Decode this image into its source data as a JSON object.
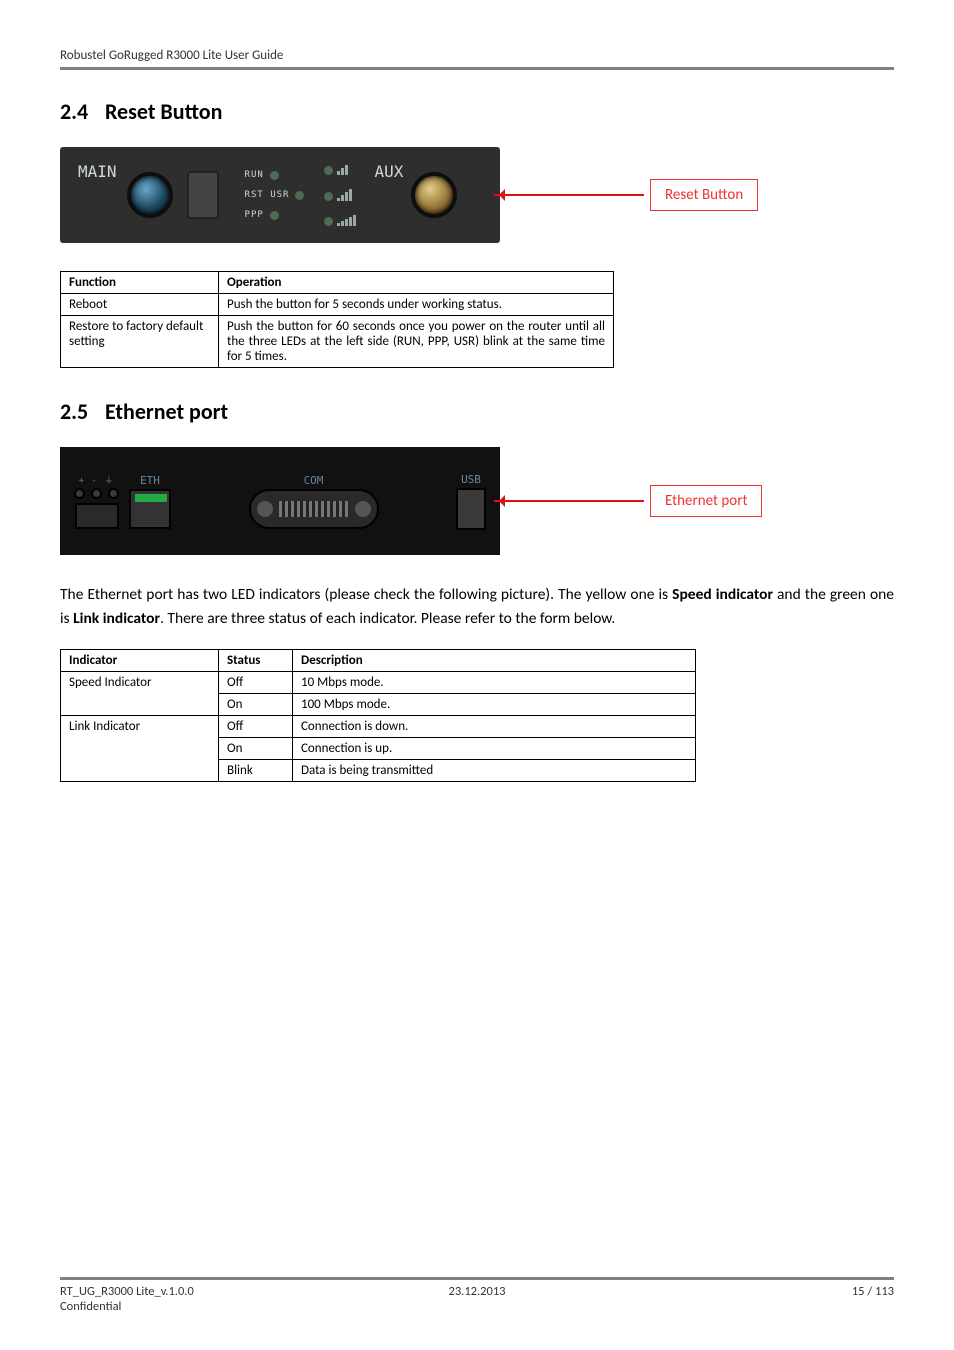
{
  "header": {
    "title": "Robustel GoRugged R3000 Lite User Guide"
  },
  "sections": {
    "s24": {
      "num": "2.4",
      "title": "Reset Button"
    },
    "s25": {
      "num": "2.5",
      "title": "Ethernet port"
    }
  },
  "device_panel1": {
    "main_label": "MAIN",
    "aux_label": "AUX",
    "led_rows": [
      "RUN",
      "RST  USR",
      "PPP"
    ],
    "callout": "Reset Button"
  },
  "table1": {
    "headers": [
      "Function",
      "Operation"
    ],
    "rows": [
      {
        "function": "Reboot",
        "operation": "Push the button for 5 seconds under working status."
      },
      {
        "function": "Restore to factory default setting",
        "operation": "Push the button for 60 seconds once you power on the router until all the three LEDs at the left side (RUN, PPP, USR) blink at the same time for 5 times."
      }
    ]
  },
  "device_panel2": {
    "labels": {
      "eth": "ETH",
      "com": "COM",
      "usb": "USB"
    },
    "tiny": "+  -  ⏚",
    "callout": "Ethernet port"
  },
  "paragraph": {
    "pre": "The Ethernet port has two LED indicators (please check the following picture). The yellow one is ",
    "b1": "Speed indicator",
    "mid": " and the green one is ",
    "b2": "Link indicator",
    "post": ". There are three status of each indicator. Please refer to the form below."
  },
  "table2": {
    "headers": [
      "Indicator",
      "Status",
      "Description"
    ],
    "groups": [
      {
        "indicator": "Speed Indicator",
        "rows": [
          {
            "status": "Off",
            "desc": "10 Mbps mode."
          },
          {
            "status": "On",
            "desc": "100 Mbps mode."
          }
        ]
      },
      {
        "indicator": "Link Indicator",
        "rows": [
          {
            "status": "Off",
            "desc": "Connection is down."
          },
          {
            "status": "On",
            "desc": "Connection is up."
          },
          {
            "status": "Blink",
            "desc": "Data is being transmitted"
          }
        ]
      }
    ]
  },
  "footer": {
    "left": "RT_UG_R3000 Lite_v.1.0.0",
    "center": "23.12.2013",
    "right": "15 / 113",
    "left2": "Confidential"
  }
}
